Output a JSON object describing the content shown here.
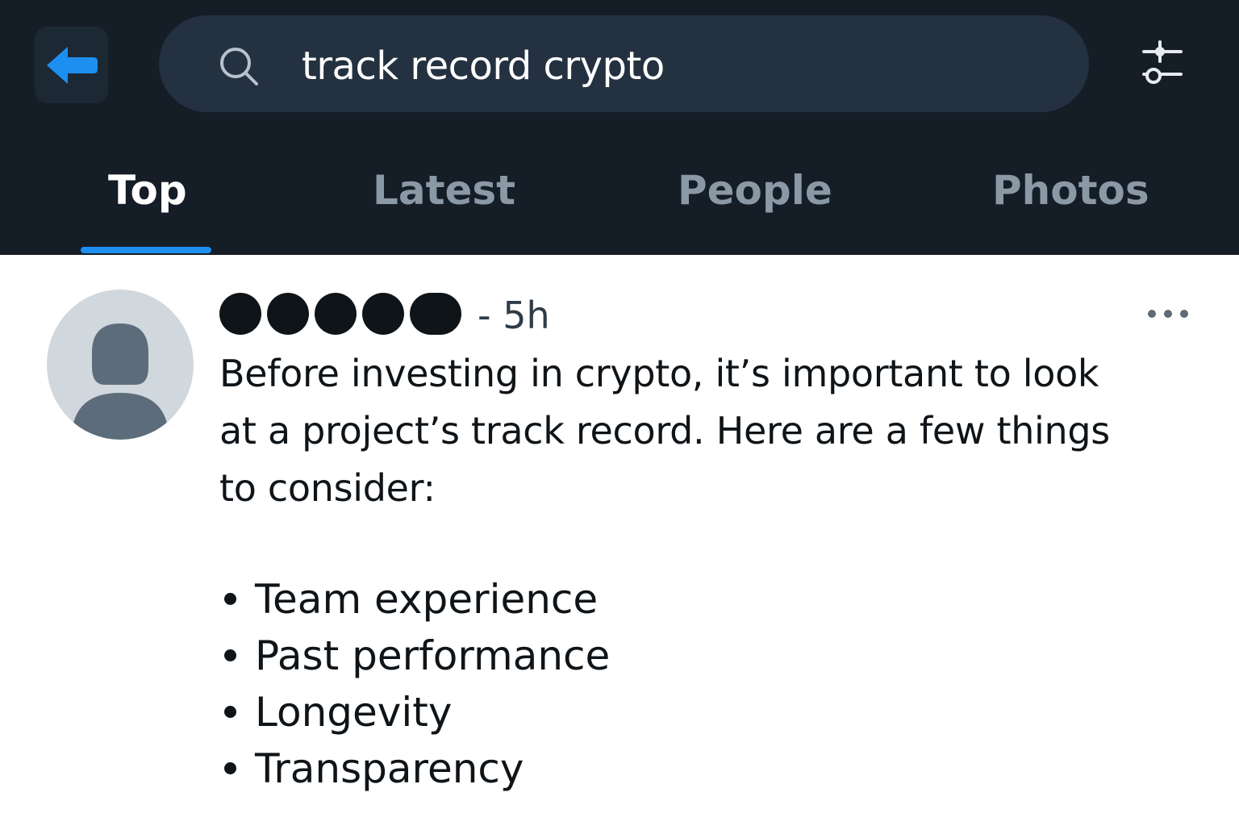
{
  "search": {
    "query": "track record crypto"
  },
  "tabs": [
    {
      "label": "Top",
      "active": true
    },
    {
      "label": "Latest",
      "active": false
    },
    {
      "label": "People",
      "active": false
    },
    {
      "label": "Photos",
      "active": false
    }
  ],
  "post": {
    "timestamp": "- 5h",
    "body_lines": [
      "Before investing  in crypto, it’s important to look",
      "at a project’s track record. Here are a few things",
      "to consider:"
    ],
    "bullets": [
      "Team experience",
      "Past performance",
      "Longevity",
      "Transparency"
    ]
  },
  "icons": {
    "back": "arrow-left-icon",
    "search": "search-icon",
    "filter": "sliders-icon",
    "more": "more-horizontal-icon",
    "avatar": "default-avatar-icon"
  },
  "colors": {
    "header_bg": "#151d27",
    "search_bg": "#243140",
    "accent": "#1d8ff0",
    "tab_inactive": "#8b98a6",
    "text_primary": "#0f1418"
  }
}
